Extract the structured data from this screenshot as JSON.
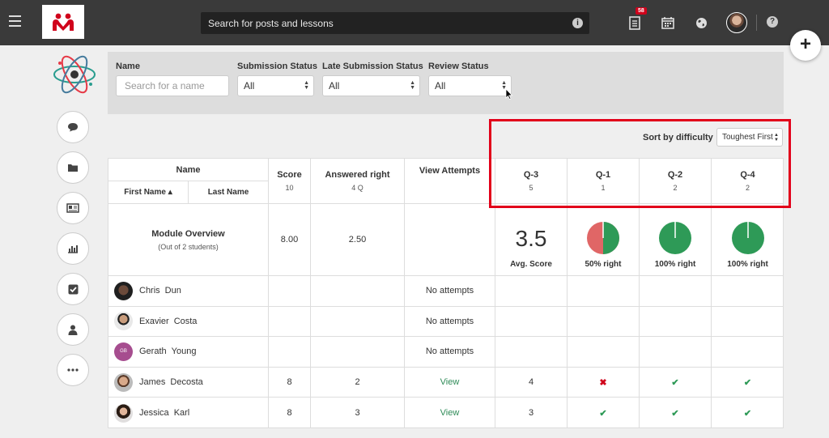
{
  "topbar": {
    "search_placeholder": "Search for posts and lessons",
    "notification_count": "58",
    "help_label": "?",
    "info_label": "i",
    "add_label": "+"
  },
  "filters": {
    "name_label": "Name",
    "name_placeholder": "Search for a name",
    "submission_label": "Submission Status",
    "submission_value": "All",
    "late_label": "Late Submission Status",
    "late_value": "All",
    "review_label": "Review Status",
    "review_value": "All"
  },
  "sort": {
    "label": "Sort by difficulty",
    "value": "Toughest First"
  },
  "table": {
    "name_header": "Name",
    "first_name": "First Name ▴",
    "last_name": "Last Name",
    "score_header": "Score",
    "score_max": "10",
    "answered_header": "Answered right",
    "answered_max": "4 Q",
    "attempts_header": "View Attempts",
    "questions": [
      {
        "label": "Q-3",
        "points": "5"
      },
      {
        "label": "Q-1",
        "points": "1"
      },
      {
        "label": "Q-2",
        "points": "2"
      },
      {
        "label": "Q-4",
        "points": "2"
      }
    ],
    "overview": {
      "title": "Module Overview",
      "subtitle": "(Out of 2 students)",
      "score": "8.00",
      "answered": "2.50",
      "avg_value": "3.5",
      "avg_label": "Avg. Score",
      "q1_label": "50% right",
      "q1_fraction": 0.5,
      "q2_label": "100% right",
      "q2_fraction": 1.0,
      "q4_label": "100% right",
      "q4_fraction": 1.0
    },
    "students": [
      {
        "first": "Chris",
        "last": "Dun",
        "score": "",
        "answered": "",
        "attempts": "No attempts",
        "q3": "",
        "q1": "",
        "q2": "",
        "q4": ""
      },
      {
        "first": "Exavier",
        "last": "Costa",
        "score": "",
        "answered": "",
        "attempts": "No attempts",
        "q3": "",
        "q1": "",
        "q2": "",
        "q4": ""
      },
      {
        "first": "Gerath",
        "last": "Young",
        "initials": "GB",
        "score": "",
        "answered": "",
        "attempts": "No attempts",
        "q3": "",
        "q1": "",
        "q2": "",
        "q4": ""
      },
      {
        "first": "James",
        "last": "Decosta",
        "score": "8",
        "answered": "2",
        "attempts": "View",
        "q3": "4",
        "q1": "✖",
        "q2": "✔",
        "q4": "✔"
      },
      {
        "first": "Jessica",
        "last": "Karl",
        "score": "8",
        "answered": "3",
        "attempts": "View",
        "q3": "3",
        "q1": "✔",
        "q2": "✔",
        "q4": "✔"
      }
    ]
  },
  "colors": {
    "correct": "#2e9a57",
    "wrong": "#e06666",
    "highlight": "#e2001a",
    "brand": "#d0021b"
  },
  "icons": {
    "menu": "hamburger-icon",
    "logo": "brand-logo",
    "notifications": "document-icon",
    "calendar": "calendar-icon",
    "globe": "globe-icon",
    "rail": [
      "chat-icon",
      "folder-icon",
      "newspaper-icon",
      "bar-chart-icon",
      "checkbox-icon",
      "user-icon",
      "more-icon"
    ]
  }
}
